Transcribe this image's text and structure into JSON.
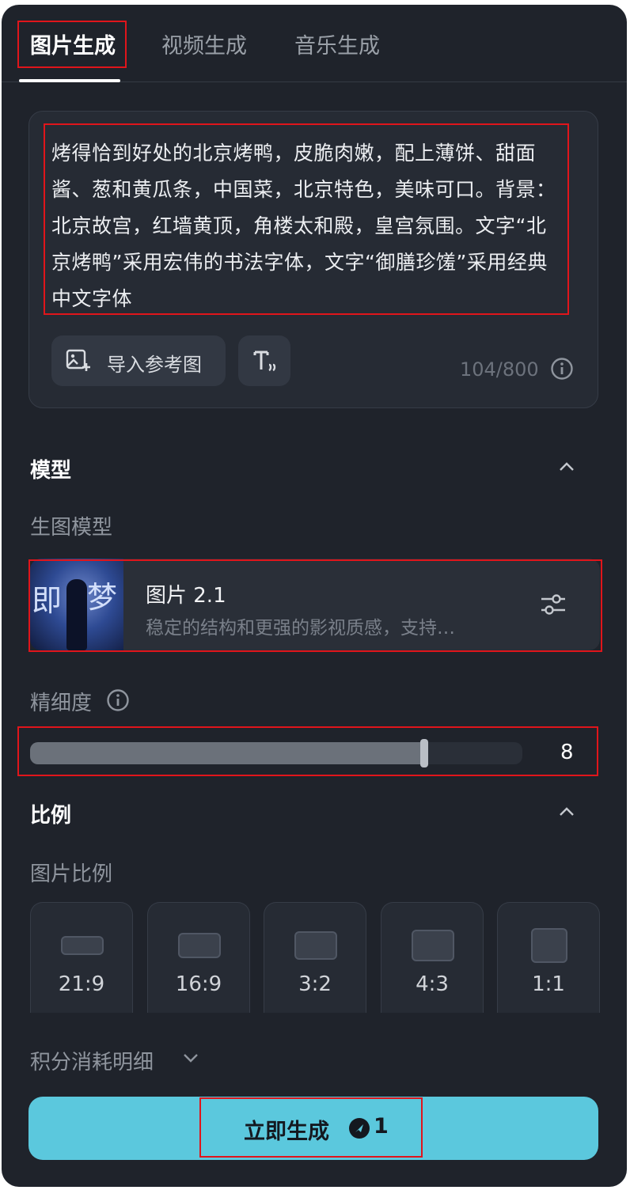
{
  "tabs": [
    {
      "label": "图片生成",
      "active": true
    },
    {
      "label": "视频生成",
      "active": false
    },
    {
      "label": "音乐生成",
      "active": false
    }
  ],
  "prompt": {
    "text": "烤得恰到好处的北京烤鸭，皮脆肉嫩，配上薄饼、甜面酱、葱和黄瓜条，中国菜，北京特色，美味可口。背景：北京故宫，红墙黄顶，角楼太和殿，皇宫氛围。文字“北京烤鸭”采用宏伟的书法字体，文字“御膳珍馐”采用经典中文字体",
    "import_label": "导入参考图",
    "char_count": "104/800"
  },
  "model_section": {
    "title": "模型",
    "sub_label": "生图模型",
    "model_name": "图片 2.1",
    "model_desc": "稳定的结构和更强的影视质感，支持…",
    "thumb_glyph_1": "即",
    "thumb_glyph_2": "梦"
  },
  "precision": {
    "label": "精细度",
    "value": "8",
    "fill_fraction": 0.8
  },
  "ratio_section": {
    "title": "比例",
    "sub_label": "图片比例",
    "options": [
      "21:9",
      "16:9",
      "3:2",
      "4:3",
      "1:1"
    ]
  },
  "credits_label": "积分消耗明细",
  "generate": {
    "label": "立即生成",
    "cost": "1"
  },
  "colors": {
    "panel_bg": "#1f232b",
    "accent": "#5bc8dd",
    "highlight_box": "#e0151b"
  }
}
